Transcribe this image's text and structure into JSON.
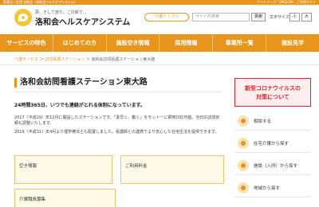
{
  "topbar": {
    "left_text": "医療法人社団 洛和会（洛和会ヘルスケアシステム）",
    "right_text": "サイトマップ｜ENGLISH｜ご利用ガイド"
  },
  "header": {
    "tagline": "夢、そして誇り。この街で…",
    "logo_name": "洛和会ヘルスケアシステム",
    "top_link": "介護トップへ",
    "search_placeholder": "サイト内検索",
    "search_button": "検索",
    "font_size_label": "文字サイズ",
    "font_sizes": [
      "小",
      "大"
    ]
  },
  "nav": {
    "items": [
      "サービスの特色",
      "はじめての方",
      "施設空き情報",
      "採用情報",
      "事業所一覧",
      "施設見学"
    ]
  },
  "breadcrumb": {
    "home": "介護サービス",
    "parent": "訪問看護ステーション",
    "current": "洛和会訪問看護ステーション東大路"
  },
  "main": {
    "title": "洛和会訪問看護ステーション東大路",
    "lead": "24時間365日、いつでも連絡がとれる体制になっています。",
    "paragraphs": [
      "2017（平成29）年12月に開設したステーションです。「素早く、動く」をモットーに即時対応可能。当日の訪問依頼も調整いたします。",
      "2019（平成31）年4月より理学療法士も配置しました。看護師との連携でより安心した在宅生活を提供できます。"
    ]
  },
  "cards": [
    {
      "label": "空き情報"
    },
    {
      "label": "ご利用料金"
    },
    {
      "label": "介護職員募集"
    }
  ],
  "sidebar": {
    "alert_line1": "新型コロナウイルスの",
    "alert_line2": "対策について",
    "items": [
      {
        "label": "相談する",
        "icon": "chat-icon"
      },
      {
        "label": "在宅介護から探す",
        "icon": "house-icon"
      },
      {
        "label": "施設（入所）から探す",
        "icon": "building-icon"
      },
      {
        "label": "地域から探す",
        "icon": "map-pin-icon"
      }
    ]
  },
  "colors": {
    "accent": "#e8951e",
    "alert": "#d8262c"
  }
}
